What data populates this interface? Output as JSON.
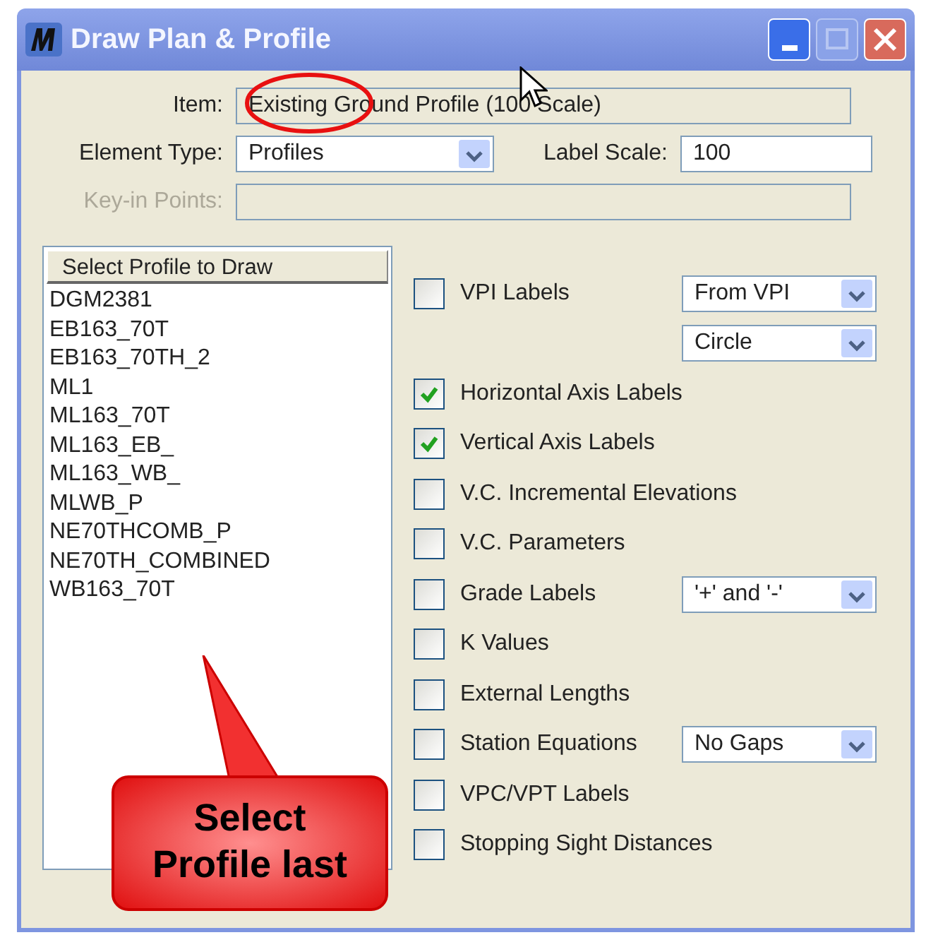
{
  "window": {
    "title": "Draw Plan & Profile"
  },
  "item": {
    "label": "Item:",
    "value": "Existing Ground Profile (100 Scale)"
  },
  "element_type": {
    "label": "Element Type:",
    "value": "Profiles"
  },
  "label_scale": {
    "label": "Label Scale:",
    "value": "100"
  },
  "key_in_points": {
    "label": "Key-in Points:",
    "disabled": true
  },
  "profile_list": {
    "header": "Select Profile to Draw",
    "items": [
      {
        "label": "DGM2381"
      },
      {
        "label": "EB163_70T"
      },
      {
        "label": "EB163_70TH_2"
      },
      {
        "label": "ML1"
      },
      {
        "label": "ML163_70T"
      },
      {
        "label": "ML163_EB_"
      },
      {
        "label": "ML163_WB_"
      },
      {
        "label": "MLWB_P"
      },
      {
        "label": "NE70THCOMB_P"
      },
      {
        "label": "NE70TH_COMBINED"
      },
      {
        "label": "WB163_70T"
      }
    ]
  },
  "options": [
    {
      "kind": "checkbox",
      "label": "VPI Labels",
      "checked": false,
      "dropdown": "From VPI"
    },
    {
      "kind": "dropdown",
      "dropdown": "Circle"
    },
    {
      "kind": "checkbox",
      "label": "Horizontal Axis Labels",
      "checked": true
    },
    {
      "kind": "checkbox",
      "label": "Vertical Axis Labels",
      "checked": true
    },
    {
      "kind": "checkbox",
      "label": "V.C. Incremental Elevations",
      "checked": false
    },
    {
      "kind": "checkbox",
      "label": "V.C. Parameters",
      "checked": false
    },
    {
      "kind": "checkbox",
      "label": "Grade Labels",
      "checked": false,
      "dropdown": "'+' and '-'"
    },
    {
      "kind": "checkbox",
      "label": "K Values",
      "checked": false
    },
    {
      "kind": "checkbox",
      "label": "External Lengths",
      "checked": false
    },
    {
      "kind": "checkbox",
      "label": "Station Equations",
      "checked": false,
      "dropdown": "No Gaps"
    },
    {
      "kind": "checkbox",
      "label": "VPC/VPT Labels",
      "checked": false
    },
    {
      "kind": "checkbox",
      "label": "Stopping Sight Distances",
      "checked": false
    }
  ],
  "callout": {
    "text": "Select Profile last"
  }
}
